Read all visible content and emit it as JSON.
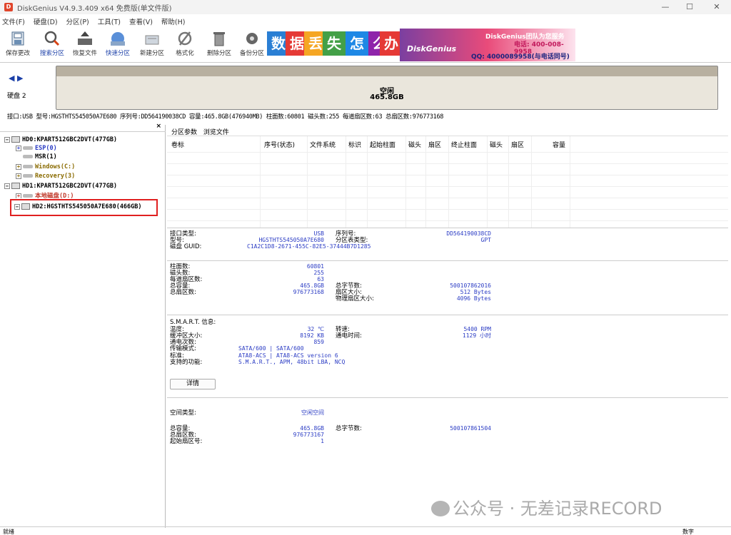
{
  "window": {
    "title": "DiskGenius V4.9.3.409 x64 免费版(单文件版)",
    "controls": [
      "—",
      "☐",
      "✕"
    ]
  },
  "menu": [
    "文件(F)",
    "硬盘(D)",
    "分区(P)",
    "工具(T)",
    "查看(V)",
    "帮助(H)"
  ],
  "toolbar": [
    {
      "label": "保存更改",
      "icon": "save-icon"
    },
    {
      "label": "搜索分区",
      "icon": "search-icon"
    },
    {
      "label": "恢复文件",
      "icon": "recover-icon"
    },
    {
      "label": "快速分区",
      "icon": "quick-partition-icon"
    },
    {
      "label": "新建分区",
      "icon": "new-partition-icon"
    },
    {
      "label": "格式化",
      "icon": "format-icon"
    },
    {
      "label": "删除分区",
      "icon": "trash-icon"
    },
    {
      "label": "备份分区",
      "icon": "backup-icon"
    }
  ],
  "banner": {
    "chars": [
      "数",
      "据",
      "丢",
      "失",
      "怎",
      "么",
      "办"
    ],
    "colors": [
      "#2a7fd4",
      "#e53935",
      "#f5a623",
      "#43a047",
      "#1e88e5",
      "#8e24aa",
      "#e53935"
    ],
    "brand": "DiskGenius团队为您服务",
    "phone": "电话: 400-008-9958",
    "qq": "QQ: 4000089958(与电话同号)"
  },
  "disk_bar": {
    "nav": "◀ ▶",
    "disk_label": "硬盘 2",
    "free_label": "空闲",
    "free_size": "465.8GB"
  },
  "info_line": "接口:USB  型号:HGSTHTS545050A7E680  序列号:DD564190038CD  容量:465.8GB(476940MB)  柱面数:60801  磁头数:255  每道扇区数:63  总扇区数:976773168",
  "tree": {
    "close": "×",
    "items": [
      {
        "text": "HD0:KPART512GBC2DVT(477GB)",
        "cls": "",
        "kind": "disk",
        "exp": "−"
      },
      {
        "text": "ESP(0)",
        "cls": "c-blue",
        "kind": "part",
        "exp": "+"
      },
      {
        "text": "MSR(1)",
        "cls": "",
        "kind": "part",
        "exp": ""
      },
      {
        "text": "Windows(C:)",
        "cls": "c-olive",
        "kind": "part",
        "exp": "+"
      },
      {
        "text": "Recovery(3)",
        "cls": "c-olive",
        "kind": "part",
        "exp": "+"
      },
      {
        "text": "HD1:KPART512GBC2DVT(477GB)",
        "cls": "",
        "kind": "disk",
        "exp": "−"
      },
      {
        "text": "本地磁盘(D:)",
        "cls": "c-red",
        "kind": "part",
        "exp": "+"
      },
      {
        "text": "HD2:HGSTHTS545050A7E680(466GB)",
        "cls": "",
        "kind": "disk",
        "exp": "−"
      }
    ]
  },
  "tabs": [
    "分区参数",
    "浏览文件"
  ],
  "grid_headers": [
    "卷标",
    "序号(状态)",
    "文件系统",
    "标识",
    "起始柱面",
    "磁头",
    "扇区",
    "终止柱面",
    "磁头",
    "扇区",
    "容量"
  ],
  "disk_info": {
    "interface_label": "接口类型:",
    "interface": "USB",
    "model_label": "型号:",
    "model": "HGSTHTS545050A7E680",
    "guid_label": "磁盘 GUID:",
    "guid": "C1A2C1D8-2671-455C-82E5-37444B7D1285",
    "serial_label": "序列号:",
    "serial": "DD564190038CD",
    "pt_label": "分区表类型:",
    "pt": "GPT",
    "cyl_label": "柱面数:",
    "cyl": "60801",
    "heads_label": "磁头数:",
    "heads": "255",
    "spt_label": "每道扇区数:",
    "spt": "63",
    "cap_label": "总容量:",
    "cap": "465.8GB",
    "sectors_label": "总扇区数:",
    "sectors": "976773168",
    "bytes_label": "总字节数:",
    "bytes": "500107862016",
    "secsize_label": "扇区大小:",
    "secsize": "512 Bytes",
    "physsec_label": "物理扇区大小:",
    "physsec": "4096 Bytes"
  },
  "smart": {
    "title": "S.M.A.R.T. 信息:",
    "temp_label": "温度:",
    "temp": "32 ℃",
    "cache_label": "缓冲区大小:",
    "cache": "8192 KB",
    "power_count_label": "通电次数:",
    "power_count": "859",
    "mode_label": "传输模式:",
    "mode": "SATA/600 | SATA/600",
    "std_label": "标准:",
    "std": "ATA8-ACS | ATA8-ACS version 6",
    "feat_label": "支持的功能:",
    "feat": "S.M.A.R.T., APM, 48bit LBA, NCQ",
    "rpm_label": "转速:",
    "rpm": "5400 RPM",
    "hours_label": "通电时间:",
    "hours": "1129 小时",
    "details_btn": "详情"
  },
  "free_space": {
    "type_label": "空间类型:",
    "type": "空闲空间",
    "cap_label": "总容量:",
    "cap": "465.8GB",
    "sectors_label": "总扇区数:",
    "sectors": "976773167",
    "start_label": "起始扇区号:",
    "start": "1",
    "bytes_label": "总字节数:",
    "bytes": "500107861504"
  },
  "watermark": "公众号 · 无差记录RECORD",
  "status": {
    "left": "就绪",
    "right": "数字"
  }
}
